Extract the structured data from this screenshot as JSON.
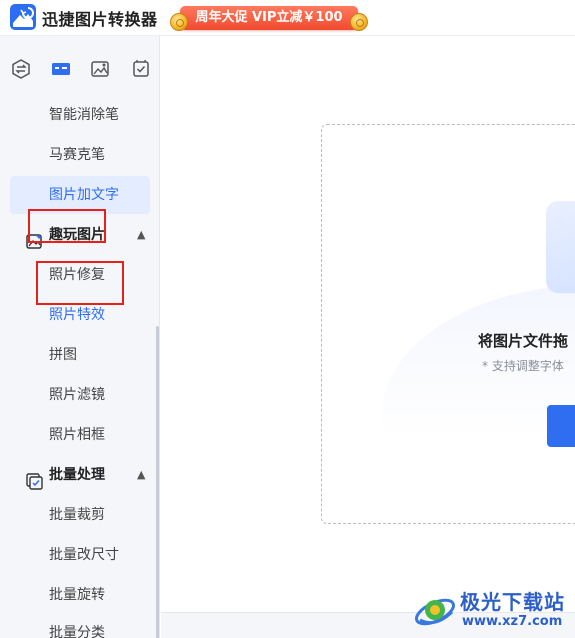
{
  "app": {
    "title": "迅捷图片转换器",
    "promo_label": "周年大促 VIP立减￥100"
  },
  "toolbar_icons": [
    "convert-icon",
    "batch-icon",
    "image-edit-icon",
    "check-icon"
  ],
  "sidebar": {
    "items": [
      {
        "label": "智能消除笔",
        "state": "normal"
      },
      {
        "label": "马赛克笔",
        "state": "normal"
      },
      {
        "label": "图片加文字",
        "state": "selected"
      }
    ],
    "fun_group": {
      "label": "趣玩图片",
      "icon": "fun-image-icon",
      "expanded": true,
      "items": [
        {
          "label": "照片修复",
          "state": "normal"
        },
        {
          "label": "照片特效",
          "state": "active"
        },
        {
          "label": "拼图",
          "state": "normal"
        },
        {
          "label": "照片滤镜",
          "state": "normal"
        },
        {
          "label": "照片相框",
          "state": "normal"
        }
      ]
    },
    "batch_group": {
      "label": "批量处理",
      "icon": "batch-process-icon",
      "expanded": true,
      "items": [
        {
          "label": "批量裁剪",
          "state": "normal"
        },
        {
          "label": "批量改尺寸",
          "state": "normal"
        },
        {
          "label": "批量旋转",
          "state": "normal"
        },
        {
          "label": "批量分类",
          "state": "normal"
        }
      ]
    }
  },
  "main": {
    "drop_title": "将图片文件拖",
    "drop_hint": "* 支持调整字体"
  },
  "watermark": {
    "name": "极光下载站",
    "url": "www.xz7.com"
  },
  "colors": {
    "accent": "#2f6ef0",
    "selected_bg": "#e4ecff",
    "promo": "#f04a2e",
    "annotation": "#e8201a"
  }
}
